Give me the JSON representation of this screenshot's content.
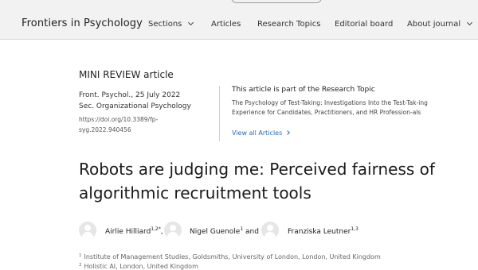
{
  "header": {
    "brand": "Frontiers in Psychology",
    "nav": [
      {
        "label": "Sections"
      },
      {
        "label": "Articles"
      },
      {
        "label": "Research Topics"
      },
      {
        "label": "Editorial board"
      },
      {
        "label": "About journal"
      }
    ]
  },
  "article": {
    "type": "MINI REVIEW article",
    "journal_date": "Front. Psychol., 25 July 2022",
    "section": "Sec. Organizational Psychology",
    "doi": "https://doi.org/10.3389/fp-syg.2022.940456",
    "title": "Robots are judging me: Perceived fairness of algorithmic recruitment tools"
  },
  "research_topic": {
    "heading": "This article is part of the Research Topic",
    "name": "The Psychology of Test-Taking: Investigations Into the Test-Tak-ing Experience for Candidates, Practitioners, and HR Profession-als",
    "view_all": "View all Articles"
  },
  "authors": [
    {
      "name": "Airlie Hilliard",
      "sup": "1,2*",
      "sep": ","
    },
    {
      "name": "Nigel Guenole",
      "sup": "1",
      "sep": " and"
    },
    {
      "name": "Franziska Leutner",
      "sup": "1,3",
      "sep": ""
    }
  ],
  "affiliations": [
    {
      "num": "1",
      "text": "Institute of Management Studies, Goldsmiths, University of London, London, United Kingdom"
    },
    {
      "num": "2",
      "text": "Holistic AI, London, United Kingdom"
    }
  ]
}
